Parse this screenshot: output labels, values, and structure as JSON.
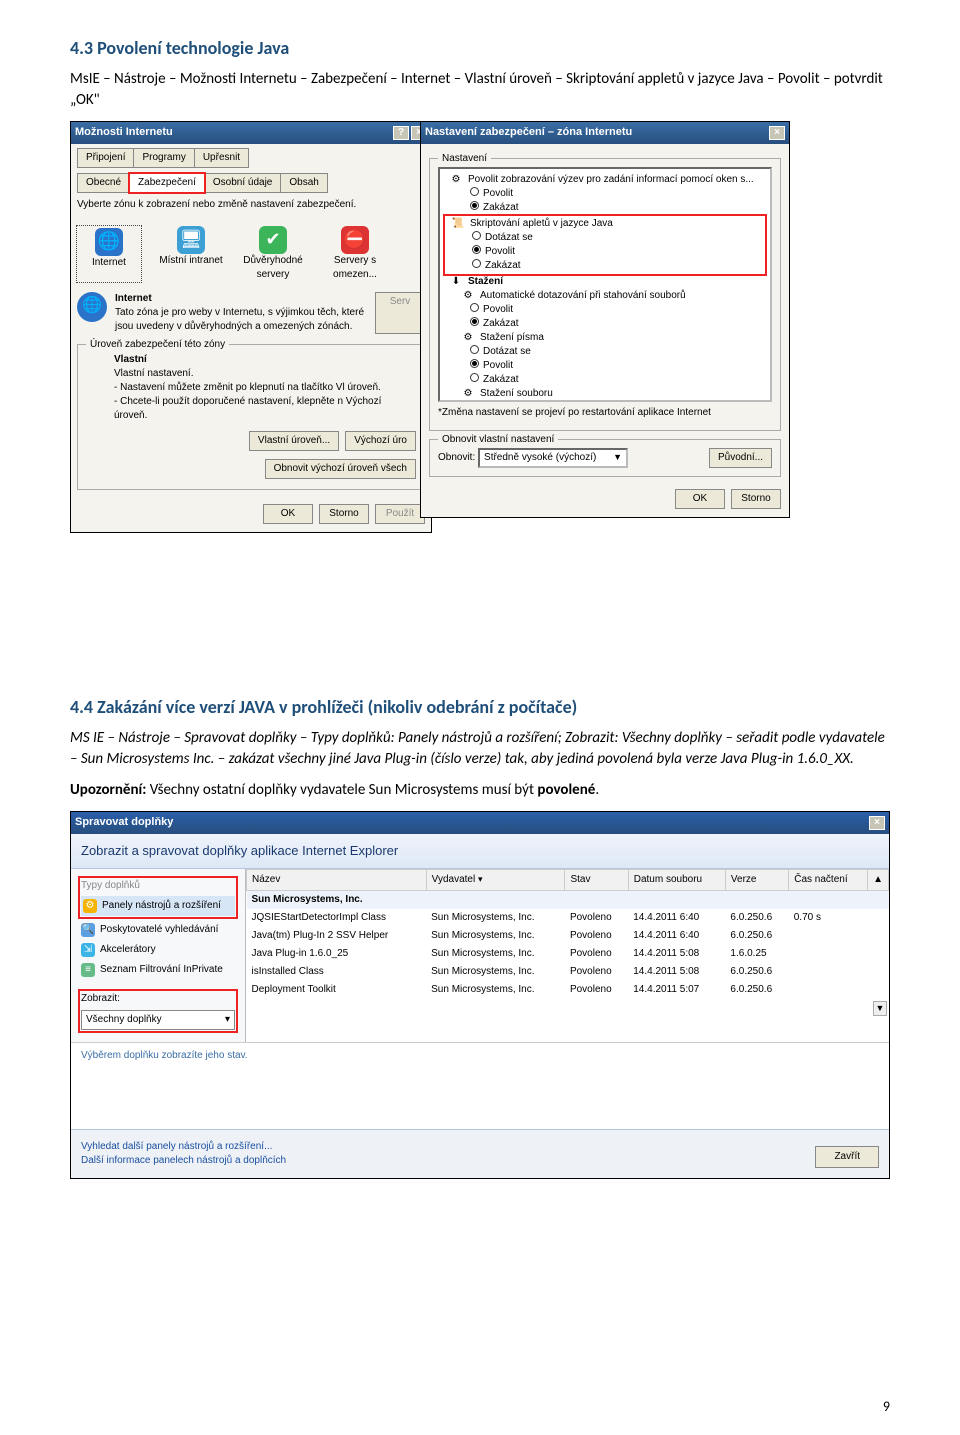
{
  "h1": "4.3 Povolení technologie Java",
  "p1": "MsIE – Nástroje – Možnosti Internetu – Zabezpečení – Internet – Vlastní úroveň – Skriptování appletů v jazyce Java – Povolit – potvrdit „OK\"",
  "iopts": {
    "title": "Možnosti Internetu",
    "tabs_row1": [
      "Připojení",
      "Programy",
      "Upřesnit"
    ],
    "tabs_row2": [
      "Obecné",
      "Zabezpečení",
      "Osobní údaje",
      "Obsah"
    ],
    "zone_prompt": "Vyberte zónu k zobrazení nebo změně nastavení zabezpečení.",
    "zones": [
      "Internet",
      "Místní intranet",
      "Důvěryhodné servery",
      "Servery s omezen..."
    ],
    "zone_name": "Internet",
    "zone_desc": "Tato zóna je pro weby v Internetu, s výjimkou těch, které jsou uvedeny v důvěryhodných a omezených zónách.",
    "servers_btn": "Serv",
    "level_legend": "Úroveň zabezpečení této zóny",
    "level_title": "Vlastní",
    "level_desc1": "Vlastní nastavení.",
    "level_desc2": "- Nastavení můžete změnit po klepnutí na tlačítko Vl úroveň.",
    "level_desc3": "- Chcete-li použít doporučené nastavení, klepněte n Výchozí úroveň.",
    "btn_custom": "Vlastní úroveň...",
    "btn_default": "Výchozí úro",
    "btn_reset": "Obnovit výchozí úroveň všech",
    "btn_ok": "OK",
    "btn_cancel": "Storno",
    "btn_apply": "Použít"
  },
  "sec": {
    "title": "Nastavení zabezpečení – zóna Internetu",
    "legend": "Nastavení",
    "i1": "Povolit zobrazování výzev pro zadání informací pomocí oken s...",
    "i1a": "Povolit",
    "i1b": "Zakázat",
    "i2": "Skriptování apletů v jazyce Java",
    "i2a": "Dotázat se",
    "i2b": "Povolit",
    "i2c": "Zakázat",
    "i3": "Stažení",
    "i3_1": "Automatické dotazování při stahování souborů",
    "i3_1a": "Povolit",
    "i3_1b": "Zakázat",
    "i3_2": "Stažení písma",
    "i3_2a": "Dotázat se",
    "i3_2b": "Povolit",
    "i3_2c": "Zakázat",
    "i3_3": "Stažení souboru",
    "note": "*Změna nastavení se projeví po restartování aplikace Internet",
    "reset_legend": "Obnovit vlastní nastavení",
    "reset_label": "Obnovit:",
    "reset_value": "Středně vysoké (výchozí)",
    "btn_reset": "Původní...",
    "btn_ok": "OK",
    "btn_cancel": "Storno"
  },
  "h2": "4.4 Zakázání více verzí JAVA v prohlížeči (nikoliv odebrání z počítače)",
  "p2": "MS IE – Nástroje – Spravovat doplňky – Typy doplňků: Panely nástrojů a rozšíření; Zobrazit: Všechny doplňky – seřadit podle vydavatele – Sun Microsystems Inc. – zakázat všechny jiné Java Plug-in (číslo verze) tak, aby jediná povolená byla verze Java Plug-in 1.6.0_XX.",
  "p3_label": "Upozornění:",
  "p3": "Všechny ostatní doplňky vydavatele Sun Microsystems musí být ",
  "p3_bold": "povolené",
  "addons": {
    "title": "Spravovat doplňky",
    "header": "Zobrazit a spravovat doplňky aplikace Internet Explorer",
    "left_h": "Typy doplňků",
    "left_items": [
      "Panely nástrojů a rozšíření",
      "Poskytovatelé vyhledávání",
      "Akcelerátory",
      "Seznam Filtrování InPrivate"
    ],
    "zobrazit": "Zobrazit:",
    "zobrazit_val": "Všechny doplňky",
    "cols": [
      "Název",
      "Vydavatel",
      "Stav",
      "Datum souboru",
      "Verze",
      "Čas načtení"
    ],
    "group": "Sun Microsystems, Inc.",
    "rows": [
      [
        "JQSIEStartDetectorImpl Class",
        "Sun Microsystems, Inc.",
        "Povoleno",
        "14.4.2011 6:40",
        "6.0.250.6",
        "0.70 s"
      ],
      [
        "Java(tm) Plug-In 2 SSV Helper",
        "Sun Microsystems, Inc.",
        "Povoleno",
        "14.4.2011 6:40",
        "6.0.250.6",
        ""
      ],
      [
        "Java Plug-in 1.6.0_25",
        "Sun Microsystems, Inc.",
        "Povoleno",
        "14.4.2011 5:08",
        "1.6.0.25",
        ""
      ],
      [
        "isInstalled Class",
        "Sun Microsystems, Inc.",
        "Povoleno",
        "14.4.2011 5:08",
        "6.0.250.6",
        ""
      ],
      [
        "Deployment Toolkit",
        "Sun Microsystems, Inc.",
        "Povoleno",
        "14.4.2011 5:07",
        "6.0.250.6",
        ""
      ]
    ],
    "status": "Výběrem doplňku zobrazíte jeho stav.",
    "foot1": "Vyhledat další panely nástrojů a rozšíření...",
    "foot2": "Další informace panelech nástrojů a doplňcích",
    "btn_close": "Zavřít"
  },
  "pagenum": "9"
}
